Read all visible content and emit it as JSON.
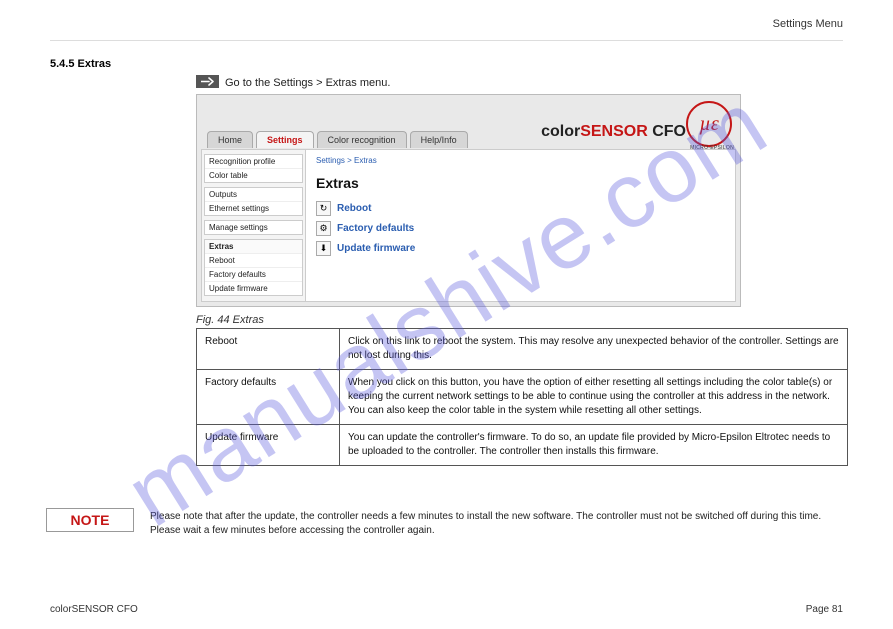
{
  "header": {
    "right_title": "Settings Menu",
    "chapter": "5.4.5  Extras",
    "instruction": "Go to the Settings > Extras menu."
  },
  "arrow_icon": "arrow-right-icon",
  "app": {
    "tabs": [
      "Home",
      "Settings",
      "Color recognition",
      "Help/Info"
    ],
    "active_tab_index": 1,
    "brand_left": "color",
    "brand_mid": "SENSOR",
    "brand_right": " CFO",
    "logo_text": "µɛ",
    "logo_sub": "MICRO-EPSILON",
    "breadcrumb": "Settings > Extras",
    "content_title": "Extras",
    "sidebar": {
      "groups": [
        {
          "rows": [
            "Recognition profile",
            "Color table"
          ]
        },
        {
          "rows": [
            "Outputs",
            "Ethernet settings"
          ]
        },
        {
          "rows": [
            "Manage settings"
          ]
        },
        {
          "head": "Extras",
          "rows": [
            "Reboot",
            "Factory defaults",
            "Update firmware"
          ]
        }
      ]
    },
    "actions": [
      {
        "icon": "↻",
        "name": "reboot-icon",
        "label": "Reboot"
      },
      {
        "icon": "⚙",
        "name": "gear-icon",
        "label": "Factory defaults"
      },
      {
        "icon": "⬇",
        "name": "download-icon",
        "label": "Update firmware"
      }
    ]
  },
  "fig_caption": "Fig. 44 Extras",
  "table": [
    {
      "k": "Reboot",
      "v": "Click on this link to reboot the system. This may resolve any unexpected behavior of the controller. Settings are not lost during this."
    },
    {
      "k": "Factory defaults",
      "v": "When you click on this button, you have the option of either resetting all settings including the color table(s) or keeping the current network settings to be able to continue using the controller at this address in the network. You can also keep the color table in the system while resetting all other settings."
    },
    {
      "k": "Update firmware",
      "v": "You can update the controller's firmware. To do so, an update file provided by Micro-Epsilon Eltrotec needs to be uploaded to the controller. The controller then installs this firmware."
    }
  ],
  "note": {
    "label": "NOTE",
    "text": "Please note that after the update, the controller needs a few minutes to install the new software. The controller must not be switched off during this time. Please wait a few minutes before accessing the controller again."
  },
  "footer": {
    "left": "colorSENSOR CFO",
    "right": "Page 81"
  },
  "watermark": "manualshive.com"
}
